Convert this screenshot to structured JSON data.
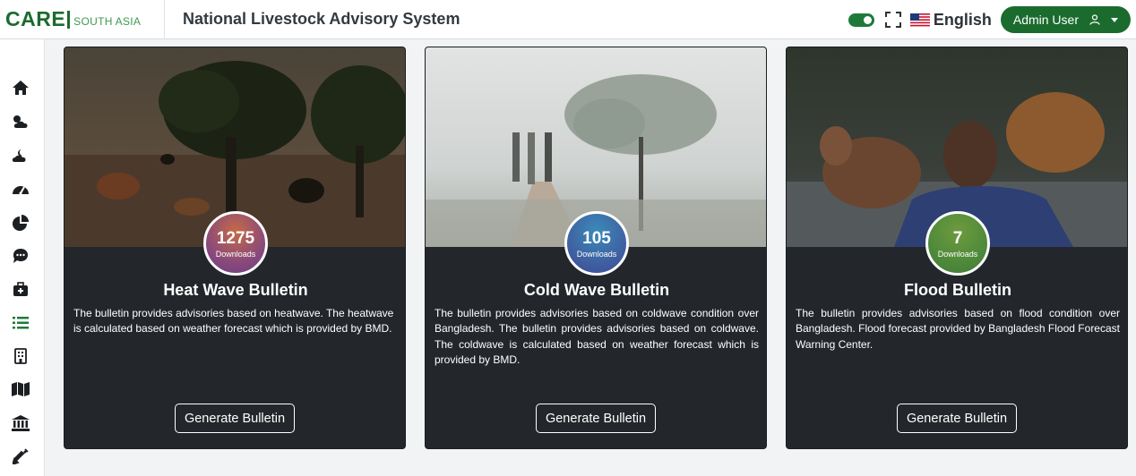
{
  "header": {
    "logo_main": "CARE",
    "logo_sub": "SOUTH ASIA",
    "title": "National Livestock Advisory System",
    "language": "English",
    "user": "Admin User",
    "toggle_on": true
  },
  "colors": {
    "brand_green": "#1b6b2f",
    "card_bg": "#23272b"
  },
  "sidebar": {
    "items": [
      {
        "icon": "home-icon"
      },
      {
        "icon": "weather-icon"
      },
      {
        "icon": "night-weather-icon"
      },
      {
        "icon": "dashboard-icon"
      },
      {
        "icon": "pie-chart-icon"
      },
      {
        "icon": "comment-dots-icon"
      },
      {
        "icon": "medkit-icon"
      },
      {
        "icon": "list-icon"
      },
      {
        "icon": "building-icon"
      },
      {
        "icon": "map-icon"
      },
      {
        "icon": "institution-icon"
      },
      {
        "icon": "syringe-icon"
      }
    ]
  },
  "cards": [
    {
      "count": "1275",
      "count_label": "Downloads",
      "title": "Heat Wave Bulletin",
      "description": "The bulletin provides advisories based on heatwave. The heatwave is calculated based on weather forecast which is provided by BMD.",
      "button": "Generate Bulletin"
    },
    {
      "count": "105",
      "count_label": "Downloads",
      "title": "Cold Wave Bulletin",
      "description": "The bulletin provides advisories based on coldwave condition over Bangladesh. The bulletin provides advisories based on coldwave. The coldwave is calculated based on weather forecast which is provided by BMD.",
      "button": "Generate Bulletin"
    },
    {
      "count": "7",
      "count_label": "Downloads",
      "title": "Flood Bulletin",
      "description": "The bulletin provides advisories based on flood condition over Bangladesh. Flood forecast provided by Bangladesh Flood Forecast Warning Center.",
      "button": "Generate Bulletin"
    }
  ]
}
